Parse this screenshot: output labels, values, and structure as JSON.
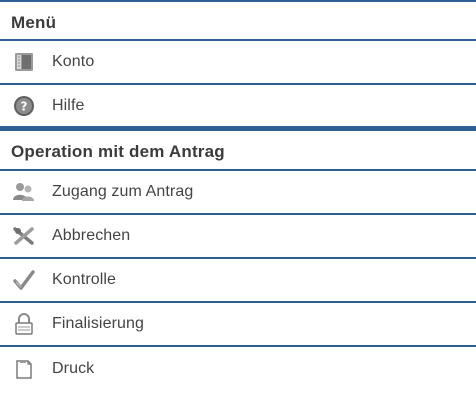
{
  "menu": {
    "title": "Menü",
    "items": [
      {
        "label": "Konto",
        "icon": "account-icon"
      },
      {
        "label": "Hilfe",
        "icon": "help-icon"
      }
    ]
  },
  "operation": {
    "title": "Operation mit dem Antrag",
    "items": [
      {
        "label": "Zugang zum Antrag",
        "icon": "access-users-icon"
      },
      {
        "label": "Abbrechen",
        "icon": "cancel-icon"
      },
      {
        "label": "Kontrolle",
        "icon": "checkmark-icon"
      },
      {
        "label": "Finalisierung",
        "icon": "lock-icon"
      },
      {
        "label": "Druck",
        "icon": "print-document-icon"
      }
    ]
  },
  "colors": {
    "rule": "#2f5e92",
    "text": "#444444"
  }
}
